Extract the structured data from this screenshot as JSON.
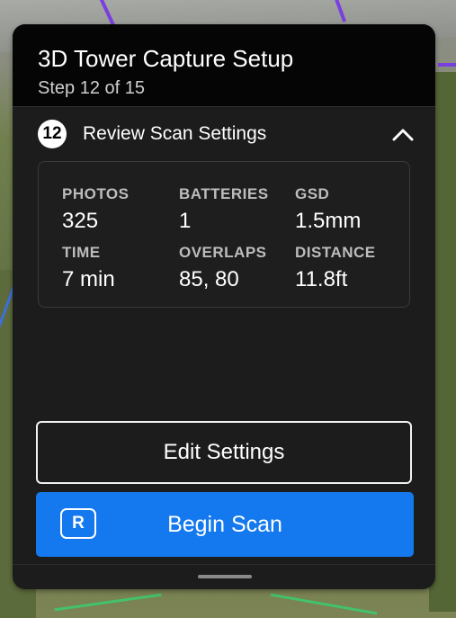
{
  "header": {
    "title": "3D Tower Capture Setup",
    "subtitle": "Step 12 of 15"
  },
  "section": {
    "step_number": "12",
    "title": "Review Scan Settings",
    "toggle_icon": "chevron-up-icon"
  },
  "stats": {
    "photos": {
      "label": "PHOTOS",
      "value": "325"
    },
    "batteries": {
      "label": "BATTERIES",
      "value": "1"
    },
    "gsd": {
      "label": "GSD",
      "value": "1.5mm"
    },
    "time": {
      "label": "TIME",
      "value": "7 min"
    },
    "overlaps": {
      "label": "OVERLAPS",
      "value": "85, 80"
    },
    "distance": {
      "label": "DISTANCE",
      "value": "11.8ft"
    }
  },
  "buttons": {
    "edit_label": "Edit Settings",
    "begin_label": "Begin Scan",
    "begin_icon_letter": "R"
  },
  "colors": {
    "accent": "#1479ee",
    "panel": "#1c1c1c",
    "header": "#050505"
  }
}
